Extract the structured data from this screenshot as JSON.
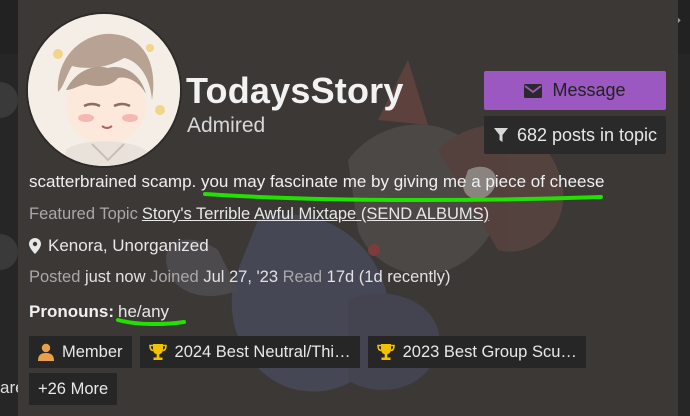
{
  "user": {
    "username": "TodaysStory",
    "title": "Admired",
    "bio": "scatterbrained scamp. you may fascinate me by giving me a piece of cheese",
    "location": "Kenora, Unorganized",
    "pronouns_label": "Pronouns:",
    "pronouns_value": "he/any"
  },
  "actions": {
    "message_label": "Message",
    "posts_label": "682 posts in topic"
  },
  "featured": {
    "label": "Featured Topic",
    "topic": "Story's Terrible Awful Mixtape (SEND ALBUMS)"
  },
  "meta": {
    "posted_label": "Posted",
    "posted_value": "just now",
    "joined_label": "Joined",
    "joined_value": "Jul 27, '23",
    "read_label": "Read",
    "read_value": "17d (1d recently)"
  },
  "badges": [
    {
      "icon": "user-icon",
      "label": "Member",
      "color": "#e8a14a"
    },
    {
      "icon": "trophy-icon",
      "label": "2024 Best Neutral/Thi…",
      "color": "#f2c200"
    },
    {
      "icon": "trophy-icon",
      "label": "2023 Best Group Scu…",
      "color": "#f2c200"
    }
  ],
  "more_badges": "+26 More",
  "left_peek_text": "are",
  "colors": {
    "card_bg": "#3b3836",
    "message_button": "#9a58c0",
    "annotation_green": "#22e000"
  }
}
